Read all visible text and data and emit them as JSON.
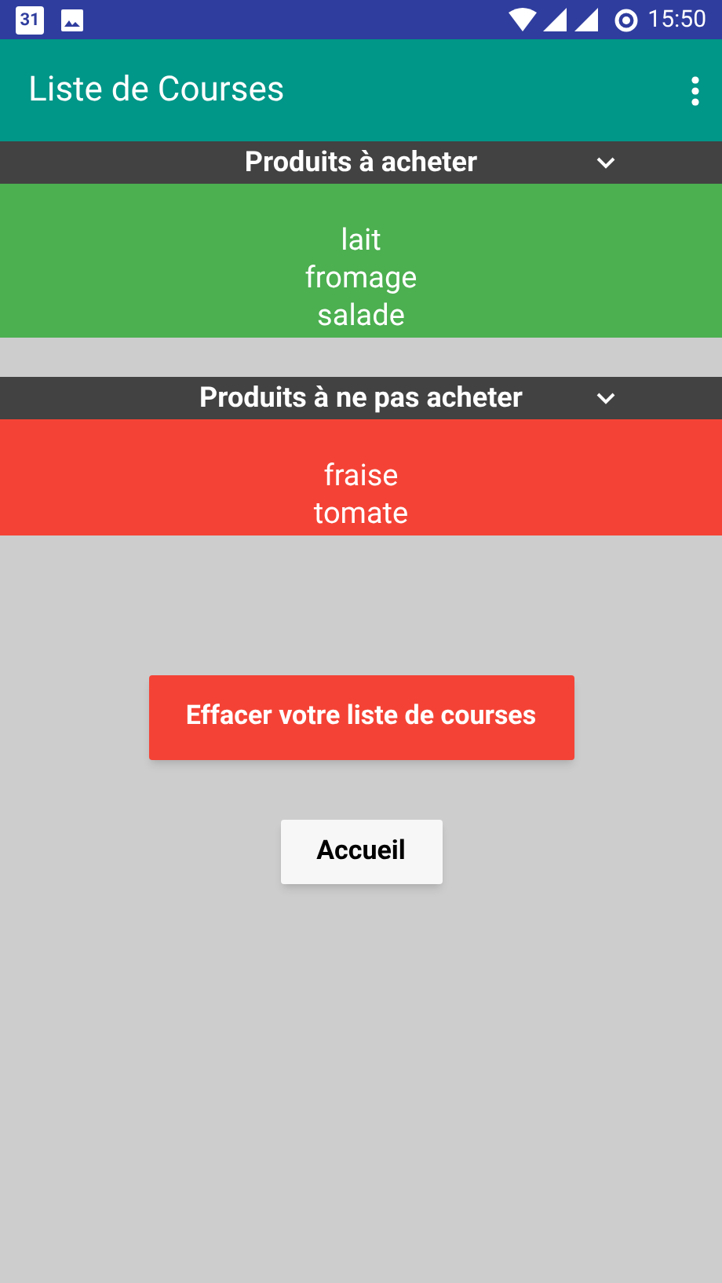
{
  "status_bar": {
    "time": "15:50",
    "calendar_day": "31"
  },
  "app_bar": {
    "title": "Liste de Courses"
  },
  "sections": [
    {
      "title": "Produits à acheter",
      "expanded": true,
      "color": "#4caf50",
      "items": [
        "lait",
        "fromage",
        "salade"
      ]
    },
    {
      "title": "Produits à ne pas acheter",
      "expanded": true,
      "color": "#f44336",
      "items": [
        "fraise",
        "tomate"
      ]
    }
  ],
  "buttons": [
    {
      "label": "Effacer votre liste de courses",
      "kind": "primary"
    },
    {
      "label": "Accueil",
      "kind": "secondary"
    }
  ]
}
